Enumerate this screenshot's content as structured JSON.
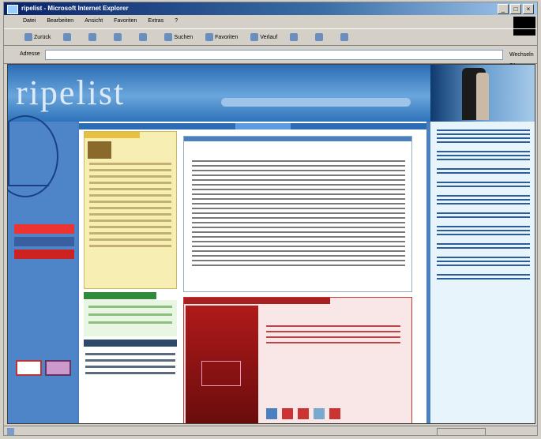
{
  "window": {
    "title": "ripelist - Microsoft Internet Explorer",
    "controls": [
      "_",
      "□",
      "×"
    ]
  },
  "menubar": {
    "items": [
      "Datei",
      "Bearbeiten",
      "Ansicht",
      "Favoriten",
      "Extras",
      "?"
    ]
  },
  "toolbar": {
    "back_label": "Zurück",
    "search_label": "Suchen",
    "favorites_label": "Favoriten",
    "history_label": "Verlauf"
  },
  "addressbar": {
    "label": "Adresse",
    "url": "",
    "go_label": "Wechseln zu"
  },
  "page": {
    "logo_text": "ripelist",
    "article_title": "",
    "article_footer": ""
  },
  "colors": {
    "accent": "#4a7fc0",
    "banner": "#2b6cb5",
    "promo": "#a82020",
    "yellow_box": "#f6eeb2"
  }
}
